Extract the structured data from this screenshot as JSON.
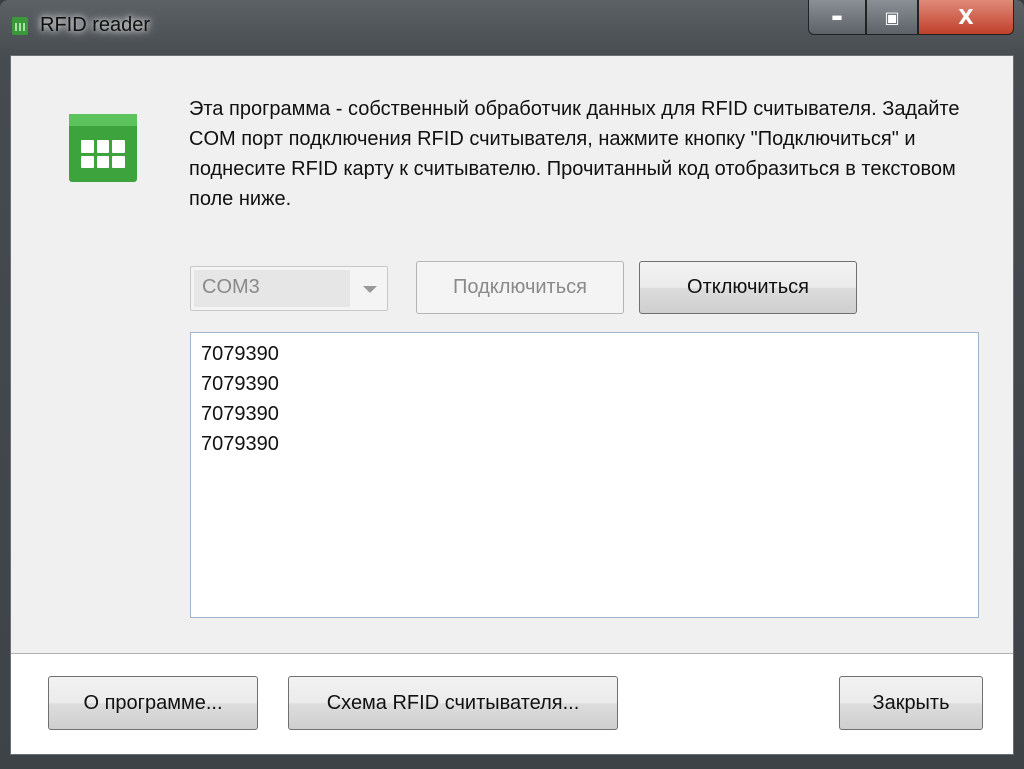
{
  "window": {
    "title": "RFID reader",
    "minimize": "▬",
    "maximize": "▣",
    "close": "X"
  },
  "description": "Эта программа - собственный обработчик данных для RFID считывателя. Задайте COM порт подключения RFID считывателя, нажмите кнопку \"Подключиться\" и поднесите RFID карту к считывателю. Прочитанный код отобразиться в текстовом поле ниже.",
  "port": {
    "selected": "COM3"
  },
  "buttons": {
    "connect": "Подключиться",
    "disconnect": "Отключиться",
    "about": "О программе...",
    "schema": "Схема RFID считывателя...",
    "close": "Закрыть"
  },
  "output": {
    "lines": [
      "7079390",
      "7079390",
      "7079390",
      "7079390"
    ]
  },
  "colors": {
    "accent": "#3da33d",
    "close_button": "#c0402a"
  }
}
